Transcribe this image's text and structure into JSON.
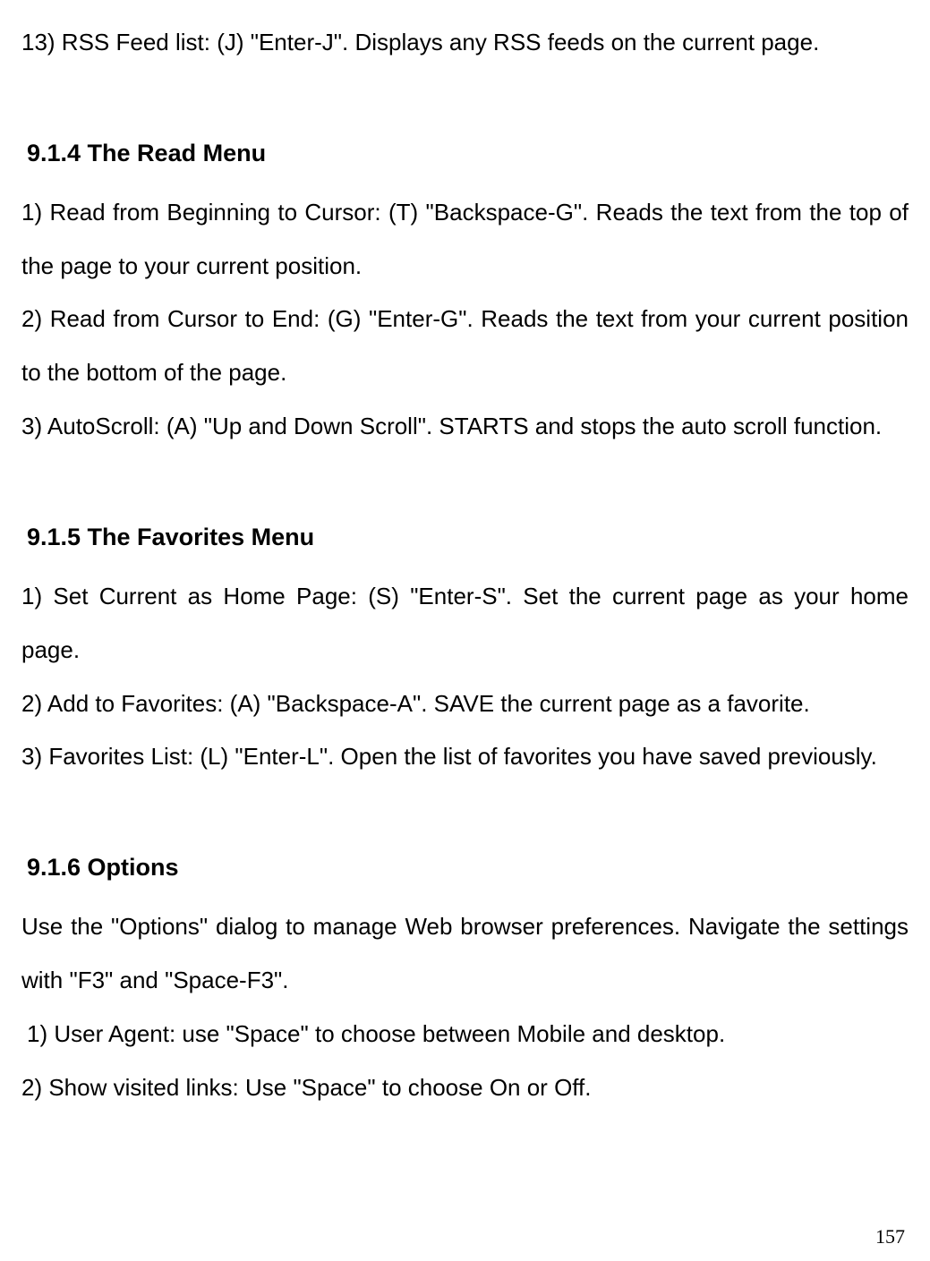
{
  "topParagraph": "13) RSS Feed list: (J) \"Enter-J\". Displays any RSS feeds on the current page.",
  "section914": {
    "heading": "9.1.4 The Read Menu",
    "items": [
      "1) Read from Beginning to Cursor: (T) \"Backspace-G\". Reads the text from the top of the page to your current position.",
      "2) Read from Cursor to End: (G) \"Enter-G\". Reads the text from your current position to the bottom of the page.",
      "3) AutoScroll: (A) \"Up and Down Scroll\". STARTS and stops the auto scroll function."
    ]
  },
  "section915": {
    "heading": "9.1.5 The Favorites Menu",
    "items": [
      "1) Set Current as Home Page: (S) \"Enter-S\". Set the current page as your home page.",
      "2) Add to Favorites: (A) \"Backspace-A\". SAVE the current page as a favorite.",
      "3) Favorites List: (L) \"Enter-L\". Open the list of favorites you have saved previously."
    ]
  },
  "section916": {
    "heading": "9.1.6 Options",
    "intro": "Use the \"Options\" dialog to manage Web browser preferences. Navigate the settings with \"F3\" and \"Space-F3\".",
    "items": [
      "1) User Agent: use \"Space\" to choose between Mobile and desktop.",
      "2) Show visited links: Use \"Space\" to choose On or Off."
    ]
  },
  "pageNumber": "157"
}
